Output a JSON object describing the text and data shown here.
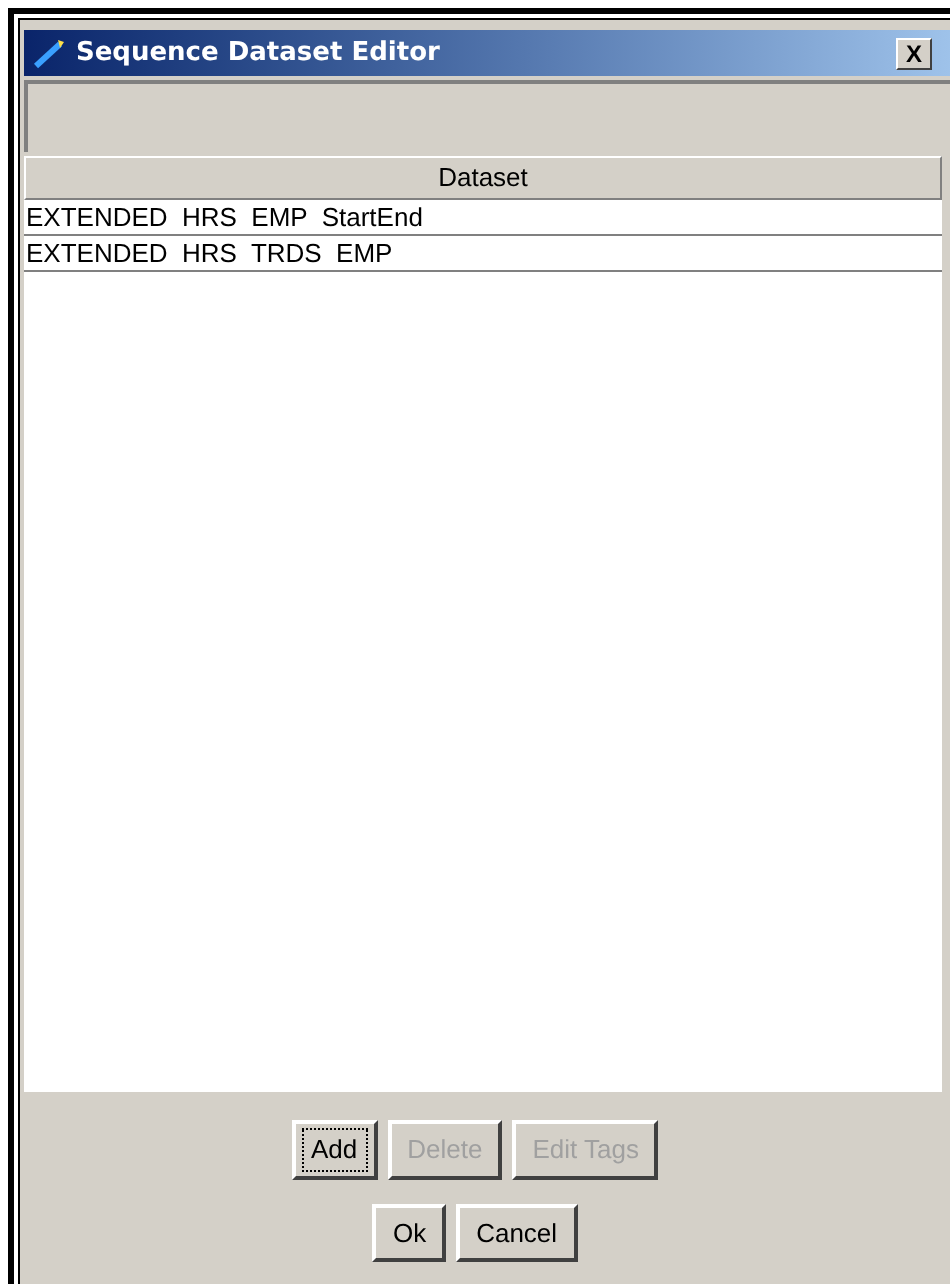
{
  "window": {
    "title": "Sequence Dataset Editor",
    "close": "X"
  },
  "table": {
    "columns": [
      "Dataset"
    ],
    "rows": [
      {
        "cells": [
          "EXTENDED  HRS  EMP  StartEnd"
        ],
        "selected": false
      },
      {
        "cells": [
          "EXTENDED  HRS  TRDS  EMP"
        ],
        "selected": false
      }
    ]
  },
  "action_buttons": [
    {
      "label": "Add",
      "disabled": false,
      "focused": true
    },
    {
      "label": "Delete",
      "disabled": true,
      "focused": false
    },
    {
      "label": "Edit Tags",
      "disabled": true,
      "focused": false
    }
  ],
  "dialog_buttons": [
    {
      "label": "Ok",
      "disabled": false,
      "focused": false
    },
    {
      "label": "Cancel",
      "disabled": false,
      "focused": false
    }
  ]
}
